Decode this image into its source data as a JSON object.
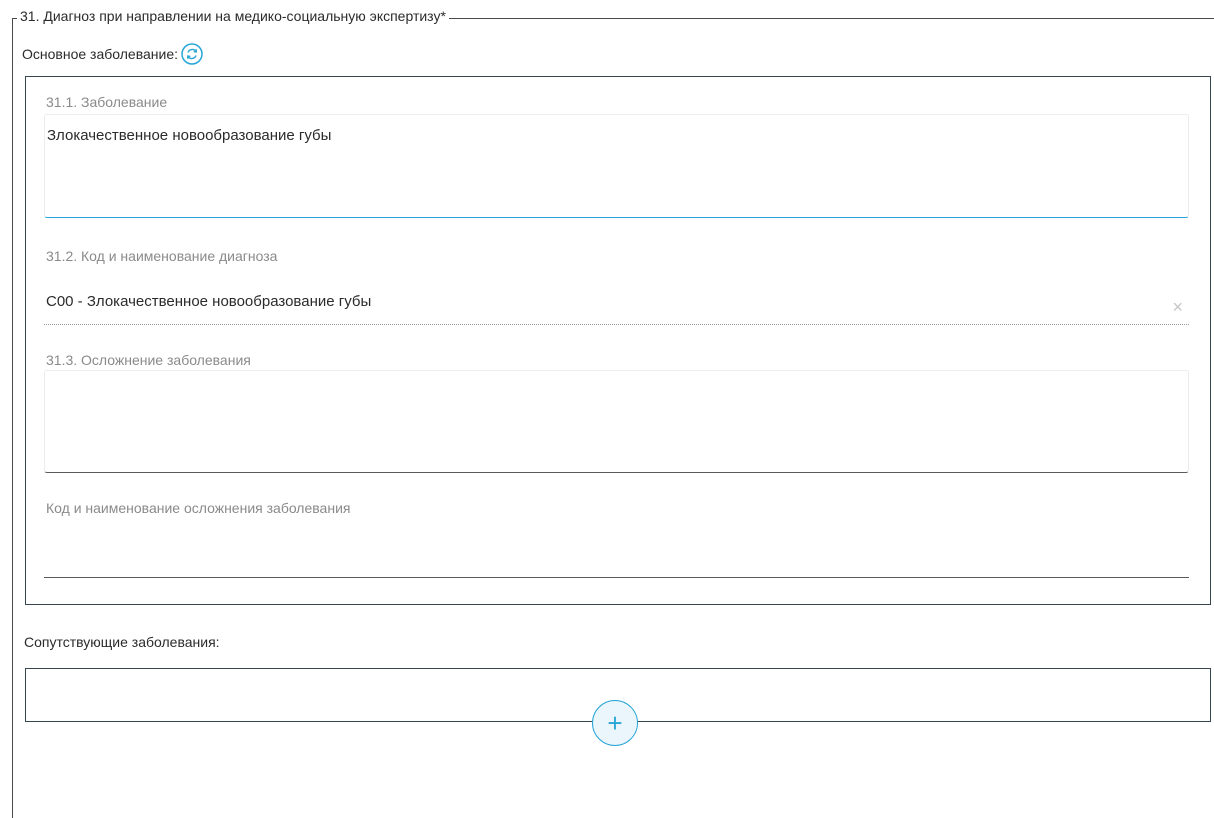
{
  "section": {
    "title": "31. Диагноз при направлении на медико-социальную экспертизу*"
  },
  "main_disease": {
    "label": "Основное заболевание:",
    "refresh_icon": "refresh-icon",
    "disease_label": "31.1. Заболевание",
    "disease_value": "Злокачественное новообразование губы",
    "diagnosis_label": "31.2. Код и наименование диагноза",
    "diagnosis_value": "C00 - Злокачественное новообразование губы",
    "clear_symbol": "×",
    "complication_label": "31.3. Осложнение заболевания",
    "complication_value": "",
    "complication_code_label": "Код и наименование осложнения заболевания",
    "complication_code_value": ""
  },
  "concomitant": {
    "label": "Сопутствующие заболевания:",
    "add_symbol": "+"
  },
  "colors": {
    "accent": "#26a5d6",
    "border": "#37474f",
    "muted_text": "#8a8a8a"
  }
}
